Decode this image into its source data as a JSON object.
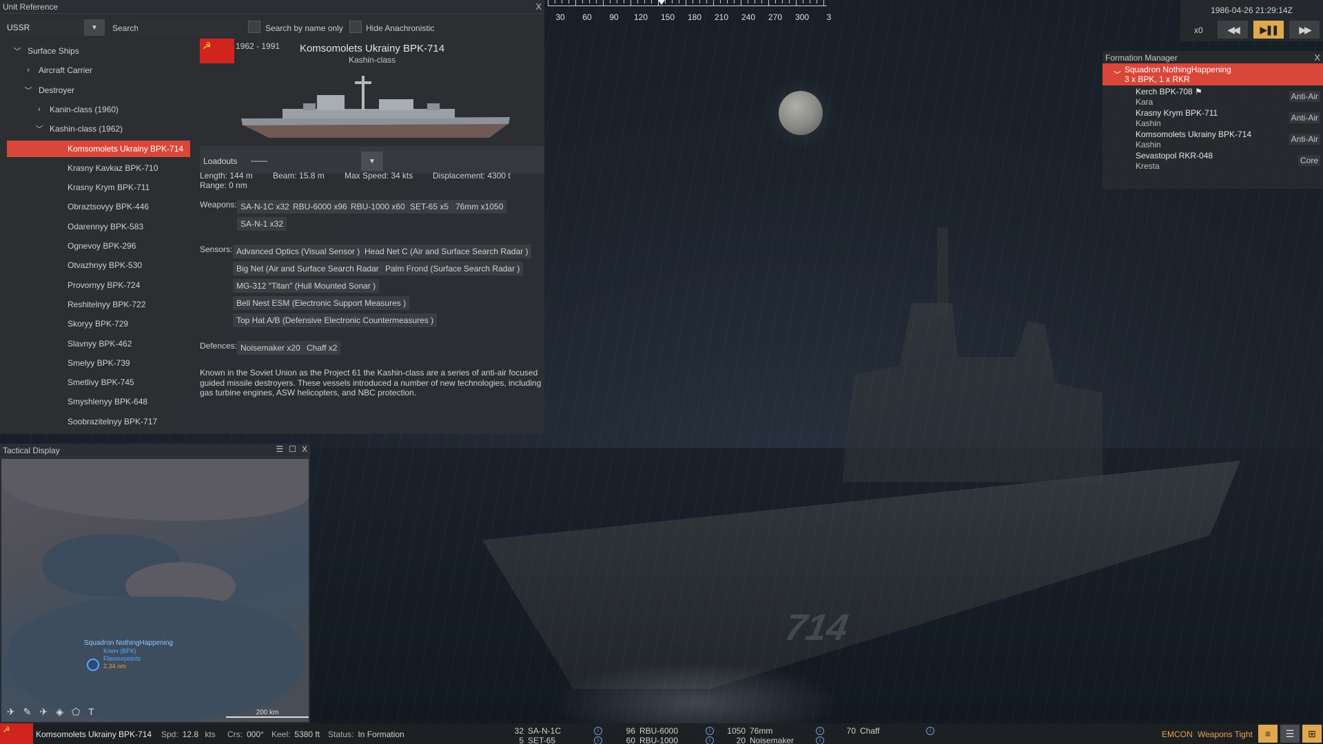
{
  "unit_reference": {
    "title": "Unit Reference",
    "close": "X",
    "nation": "USSR",
    "search_label": "Search",
    "search_placeholder": "",
    "search_by_name_label": "Search by name only",
    "hide_anachronistic_label": "Hide Anachronistic",
    "tree": [
      {
        "label": "Surface Ships",
        "level": 0,
        "chevron": "﹀"
      },
      {
        "label": "Aircraft Carrier",
        "level": 1,
        "chevron": "›"
      },
      {
        "label": "Destroyer",
        "level": 1,
        "chevron": "﹀"
      },
      {
        "label": "Kanin-class (1960)",
        "level": 2,
        "chevron": "›"
      },
      {
        "label": "Kashin-class (1962)",
        "level": 2,
        "chevron": "﹀"
      },
      {
        "label": "Komsomolets Ukrainy BPK-714",
        "level": 3,
        "chevron": "",
        "selected": true
      },
      {
        "label": "Krasny Kavkaz BPK-710",
        "level": 3,
        "chevron": ""
      },
      {
        "label": "Krasny Krym BPK-711",
        "level": 3,
        "chevron": ""
      },
      {
        "label": "Obraztsovyy BPK-446",
        "level": 3,
        "chevron": ""
      },
      {
        "label": "Odarennyy BPK-583",
        "level": 3,
        "chevron": ""
      },
      {
        "label": "Ognevoy BPK-296",
        "level": 3,
        "chevron": ""
      },
      {
        "label": "Otvazhnyy BPK-530",
        "level": 3,
        "chevron": ""
      },
      {
        "label": "Provornyy BPK-724",
        "level": 3,
        "chevron": ""
      },
      {
        "label": "Reshitelnyy BPK-722",
        "level": 3,
        "chevron": ""
      },
      {
        "label": "Skoryy BPK-729",
        "level": 3,
        "chevron": ""
      },
      {
        "label": "Slavnyy BPK-462",
        "level": 3,
        "chevron": ""
      },
      {
        "label": "Smelyy BPK-739",
        "level": 3,
        "chevron": ""
      },
      {
        "label": "Smetlivy BPK-745",
        "level": 3,
        "chevron": ""
      },
      {
        "label": "Smyshlenyy BPK-648",
        "level": 3,
        "chevron": ""
      },
      {
        "label": "Soobrazitelnyy BPK-717",
        "level": 3,
        "chevron": ""
      }
    ],
    "detail": {
      "flag_glyph": "☭",
      "years": "1962 - 1991",
      "name": "Komsomolets Ukrainy BPK-714",
      "class": "Kashin-class",
      "loadouts_label": "Loadouts",
      "loadout_value": "——",
      "stats": {
        "length": "Length: 144 m",
        "beam": "Beam: 15.8 m",
        "max_speed": "Max Speed: 34 kts",
        "displacement": "Displacement: 4300 t",
        "range": "Range: 0 nm"
      },
      "weapons_label": "Weapons:",
      "weapons": [
        "SA-N-1C x32",
        "RBU-6000 x96",
        "RBU-1000 x60",
        "SET-65 x5",
        "76mm x1050",
        "SA-N-1 x32"
      ],
      "sensors_label": "Sensors:",
      "sensors": [
        "Advanced Optics (Visual Sensor )",
        "Head Net C (Air and Surface Search Radar )",
        "Big Net (Air and Surface Search Radar )",
        "Palm Frond (Surface Search Radar )",
        "MG-312 \"Titan\" (Hull Mounted Sonar )",
        "Bell Nest ESM (Electronic Support Measures )",
        "Top Hat A/B (Defensive Electronic Countermeasures )"
      ],
      "defences_label": "Defences:",
      "defences": [
        "Noisemaker x20",
        "Chaff x2"
      ],
      "description": "Known in the Soviet Union as the Project 61 the Kashin-class are a series of anti-air focused guided missile destroyers. These vessels introduced a number of new technologies, including gas turbine engines, ASW helicopters, and NBC protection."
    }
  },
  "compass": {
    "labels": [
      "30",
      "60",
      "90",
      "120",
      "150",
      "180",
      "210",
      "240",
      "270",
      "300",
      "3"
    ]
  },
  "time_control": {
    "datetime": "1986-04-26 21:29:14Z",
    "speed": "x0",
    "rewind_icon": "◀◀",
    "pause_icon": "▶❚❚",
    "forward_icon": "▶▶"
  },
  "formation_manager": {
    "title": "Formation Manager",
    "close": "X",
    "group_name": "Squadron NothingHappening",
    "group_summary": "3 x BPK, 1 x RKR",
    "members": [
      {
        "name": "Kerch BPK-708",
        "class": "Kara",
        "role": "Anti-Air",
        "flag": true
      },
      {
        "name": "Krasny Krym BPK-711",
        "class": "Kashin",
        "role": "Anti-Air"
      },
      {
        "name": "Komsomolets Ukrainy BPK-714",
        "class": "Kashin",
        "role": "Anti-Air"
      },
      {
        "name": "Sevastopol RKR-048",
        "class": "Kresta",
        "role": "Core"
      }
    ]
  },
  "tactical_display": {
    "title": "Tactical Display",
    "menu_icon": "☰",
    "maximize_icon": "☐",
    "close": "X",
    "squadron_label": "Squadron NothingHappening",
    "squadron_sub1": "Ключ (ВРК)",
    "squadron_sub2": "Flavourpoints",
    "squadron_sub3": "2.34 nm",
    "scale_label": "200 km",
    "tools": [
      "✈",
      "✎",
      "✈",
      "◈",
      "⬠",
      "T"
    ]
  },
  "bottom_bar": {
    "flag_glyph": "☭",
    "unit_name": "Komsomolets Ukrainy BPK-714",
    "spd_label": "Spd:",
    "spd_value": "12.8",
    "spd_unit": "kts",
    "crs_label": "Crs:",
    "crs_value": "000°",
    "keel_label": "Keel:",
    "keel_value": "5380 ft",
    "status_label": "Status:",
    "status_value": "In Formation",
    "ammo": [
      {
        "count": "32",
        "name": "SA-N-1C"
      },
      {
        "count": "5",
        "name": "SET-65"
      },
      {
        "count": "96",
        "name": "RBU-6000"
      },
      {
        "count": "60",
        "name": "RBU-1000"
      },
      {
        "count": "1050",
        "name": "76mm"
      },
      {
        "count": "20",
        "name": "Noisemaker"
      },
      {
        "count": "70",
        "name": "Chaff"
      }
    ],
    "emcon": "EMCON",
    "weapons_state": "Weapons Tight"
  }
}
